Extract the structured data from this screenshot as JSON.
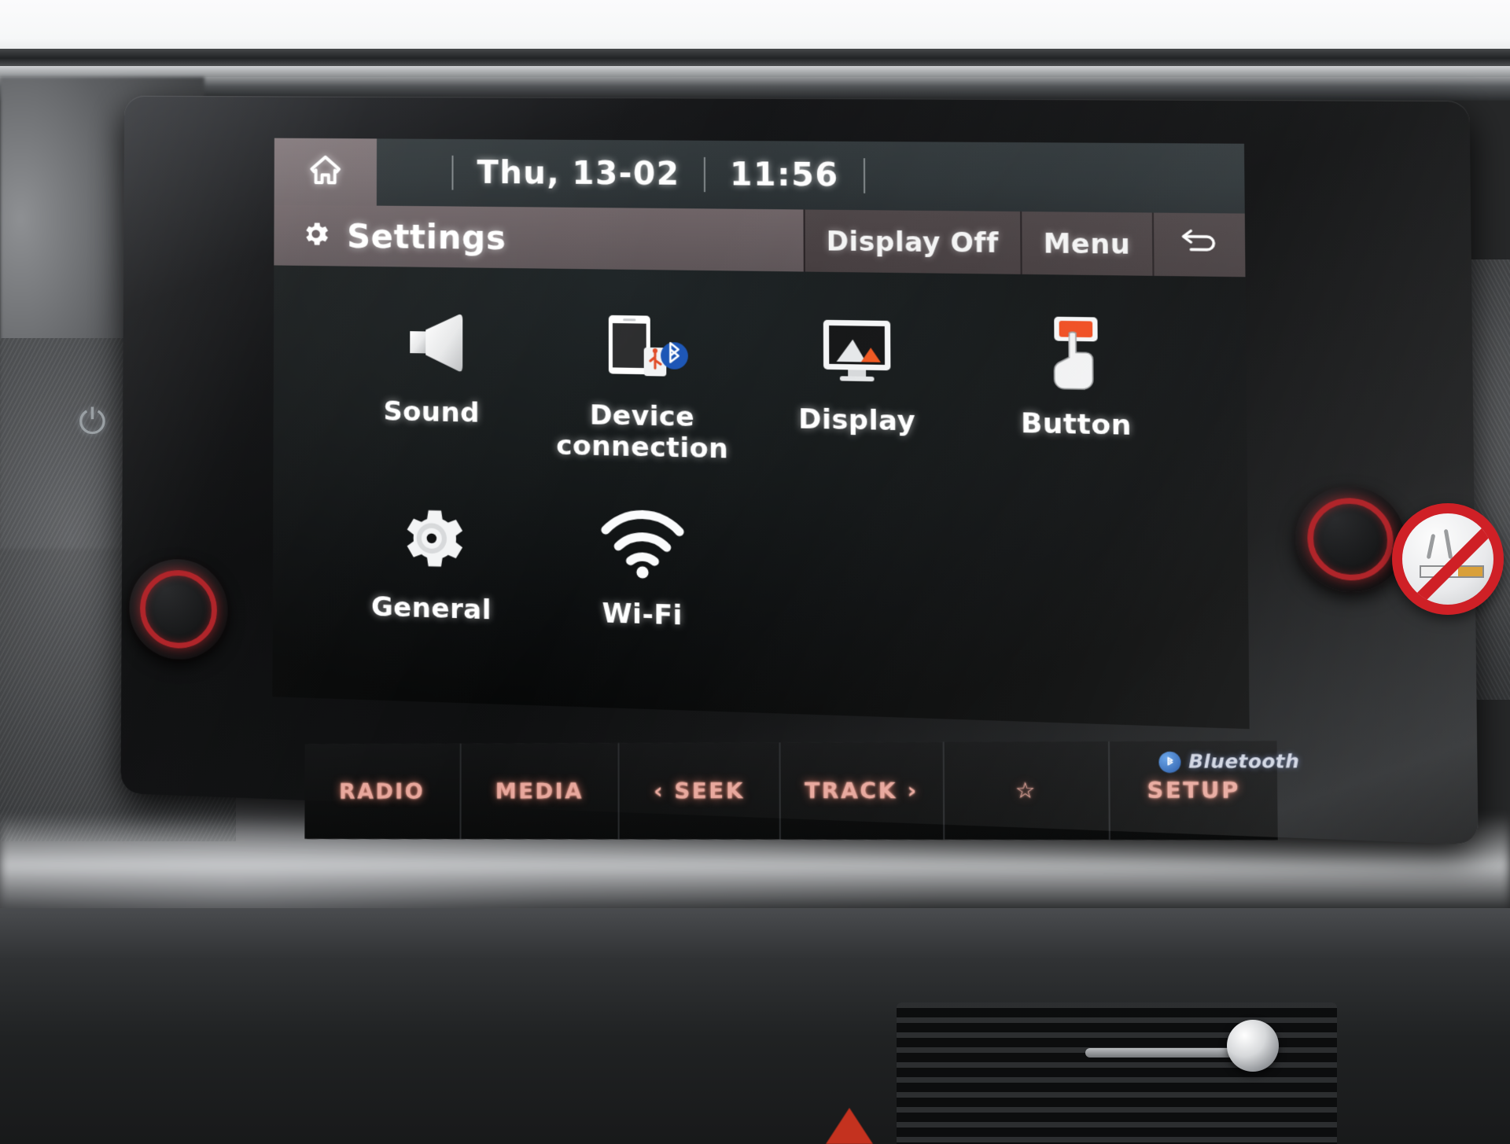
{
  "status_bar": {
    "home_icon": "home-icon",
    "date": "Thu, 13-02",
    "time": "11:56"
  },
  "title_bar": {
    "gear_icon": "gear-icon",
    "title": "Settings",
    "buttons": [
      {
        "label": "Display Off",
        "name": "display-off-button"
      },
      {
        "label": "Menu",
        "name": "menu-button"
      }
    ],
    "back_icon": "back-arrow-icon"
  },
  "menu": {
    "row1": [
      {
        "label": "Sound",
        "icon": "speaker-icon"
      },
      {
        "label": "Device\nconnection",
        "line1": "Device",
        "line2": "connection",
        "icon": "phone-bluetooth-usb-icon"
      },
      {
        "label": "Display",
        "icon": "monitor-picture-icon"
      },
      {
        "label": "Button",
        "icon": "hand-press-button-icon"
      }
    ],
    "row2": [
      {
        "label": "General",
        "icon": "gear-icon"
      },
      {
        "label": "Wi-Fi",
        "icon": "wifi-icon"
      }
    ]
  },
  "hardware_buttons": [
    {
      "label": "RADIO",
      "name": "radio-button"
    },
    {
      "label": "MEDIA",
      "name": "media-button"
    },
    {
      "label": "‹ SEEK",
      "name": "seek-button"
    },
    {
      "label": "TRACK ›",
      "name": "track-button"
    },
    {
      "label": "☆",
      "name": "favorite-star-button"
    },
    {
      "label": "SETUP",
      "name": "setup-button"
    }
  ],
  "bluetooth": {
    "label": "Bluetooth",
    "icon": "bluetooth-icon"
  },
  "colors": {
    "accent_orange": "#f05a28",
    "button_red": "#e8a79c",
    "title_bar": "#655b5e",
    "status_bar": "#2b3235",
    "screen_bg": "#0a0c0d"
  }
}
